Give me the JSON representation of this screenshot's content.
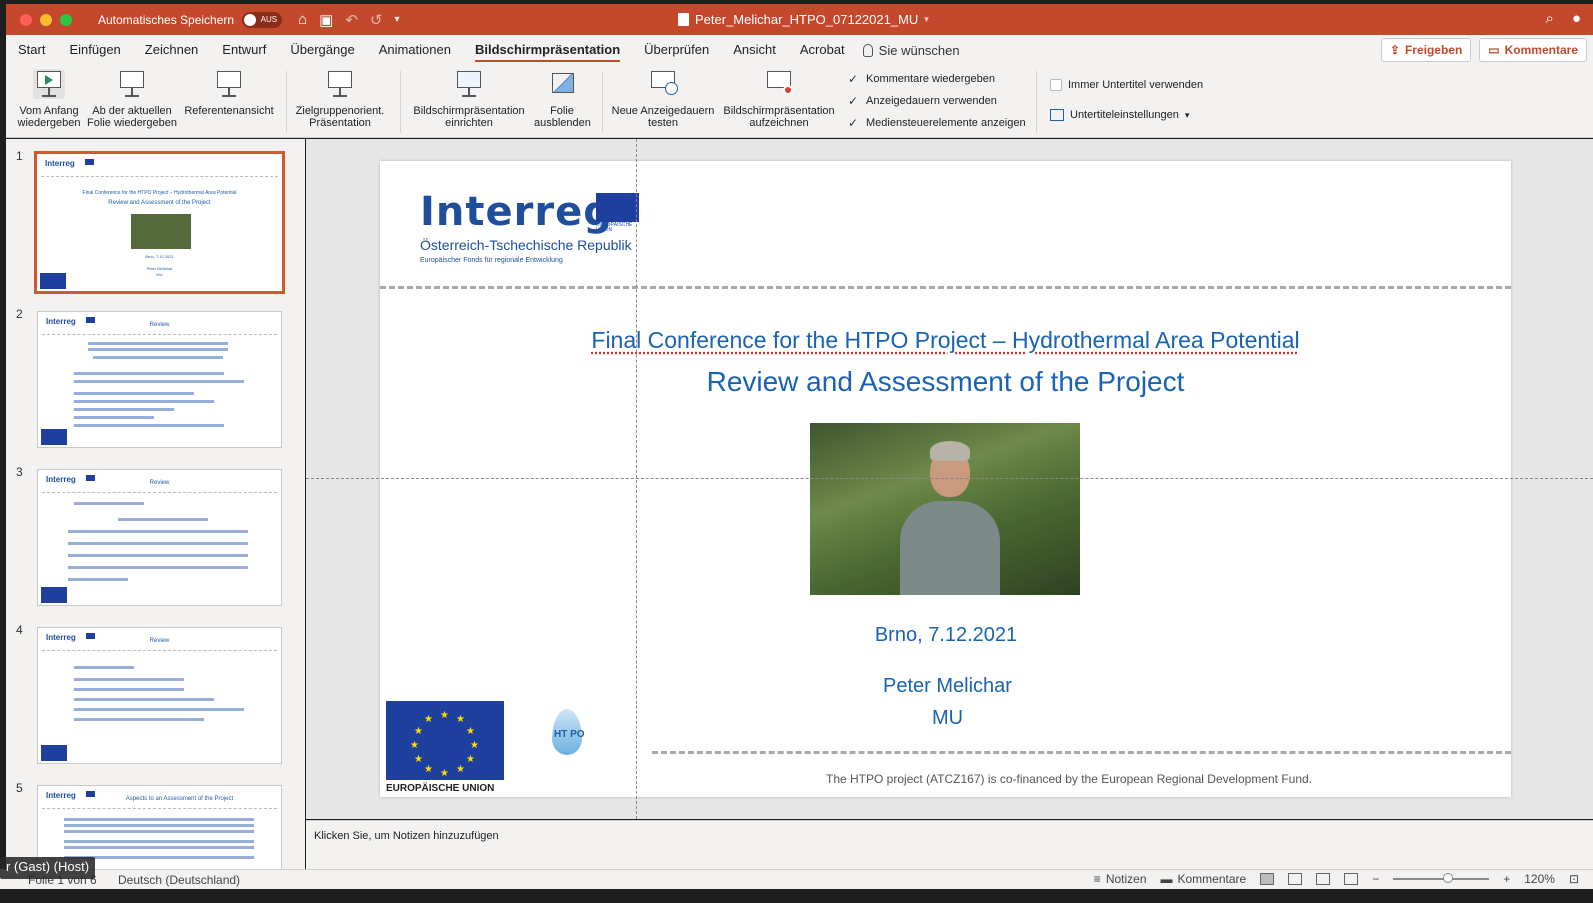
{
  "titlebar": {
    "autosave_label": "Automatisches Speichern",
    "autosave_state": "AUS",
    "document_title": "Peter_Melichar_HTPO_07122021_MU",
    "bg_color": "#c4492c"
  },
  "ribbon_tabs": [
    "Start",
    "Einfügen",
    "Zeichnen",
    "Entwurf",
    "Übergänge",
    "Animationen",
    "Bildschirmpräsentation",
    "Überprüfen",
    "Ansicht",
    "Acrobat"
  ],
  "active_tab": "Bildschirmpräsentation",
  "tell_me": "Sie wünschen",
  "share": {
    "freigeben": "Freigeben",
    "kommentare": "Kommentare"
  },
  "ribbon": {
    "from_start_l1": "Vom Anfang",
    "from_start_l2": "wiedergeben",
    "from_current_l1": "Ab der aktuellen",
    "from_current_l2": "Folie wiedergeben",
    "presenter_view": "Referentenansicht",
    "custom_show_l1": "Zielgruppenorient.",
    "custom_show_l2": "Präsentation",
    "setup_l1": "Bildschirmpräsentation",
    "setup_l2": "einrichten",
    "hide_slide_l1": "Folie",
    "hide_slide_l2": "ausblenden",
    "rehearse_l1": "Neue Anzeigedauern",
    "rehearse_l2": "testen",
    "record_l1": "Bildschirmpräsentation",
    "record_l2": "aufzeichnen",
    "check_comments": "Kommentare wiedergeben",
    "check_timings": "Anzeigedauern verwenden",
    "check_media": "Mediensteuerelemente anzeigen",
    "check_subtitles": "Immer Untertitel verwenden",
    "subtitle_settings": "Untertiteleinstellungen"
  },
  "thumbnails": [
    {
      "num": "1",
      "title": "Final Conference for the HTPO Project – Hydrothermal Area Potential",
      "subtitle": "Review and Assessment of the Project",
      "city": "Brno, 7.12.2021",
      "name": "Peter Melichar",
      "inst": "MU"
    },
    {
      "num": "2",
      "title": "Review"
    },
    {
      "num": "3",
      "title": "Review"
    },
    {
      "num": "4",
      "title": "Review"
    },
    {
      "num": "5",
      "title": "Aspects to an Assessment of the Project"
    }
  ],
  "slide": {
    "logo_word": "Interreg",
    "logo_flag_caption": "EUROPÄISCHE UNION",
    "logo_sub": "Österreich-Tschechische Republik",
    "logo_sub2": "Europäischer Fonds für regionale Entwicklung",
    "title": "Final Conference for the HTPO Project – Hydrothermal Area Potential",
    "subtitle": "Review and Assessment of the Project",
    "place_date": "Brno, 7.12.2021",
    "presenter": "Peter Melichar",
    "institution": "MU",
    "eu_caption": "EUROPÄISCHE UNION",
    "htpo_logo": "HT PO",
    "footer": "The HTPO project (ATCZ167) is co-financed by the European Regional Development Fund."
  },
  "notes_placeholder": "Klicken Sie, um Notizen hinzuzufügen",
  "status": {
    "slide_counter": "Folie 1 von 6",
    "language": "Deutsch (Deutschland)",
    "notes": "Notizen",
    "comments": "Kommentare",
    "zoom": "120%",
    "host_label": "r (Gast) (Host)"
  }
}
